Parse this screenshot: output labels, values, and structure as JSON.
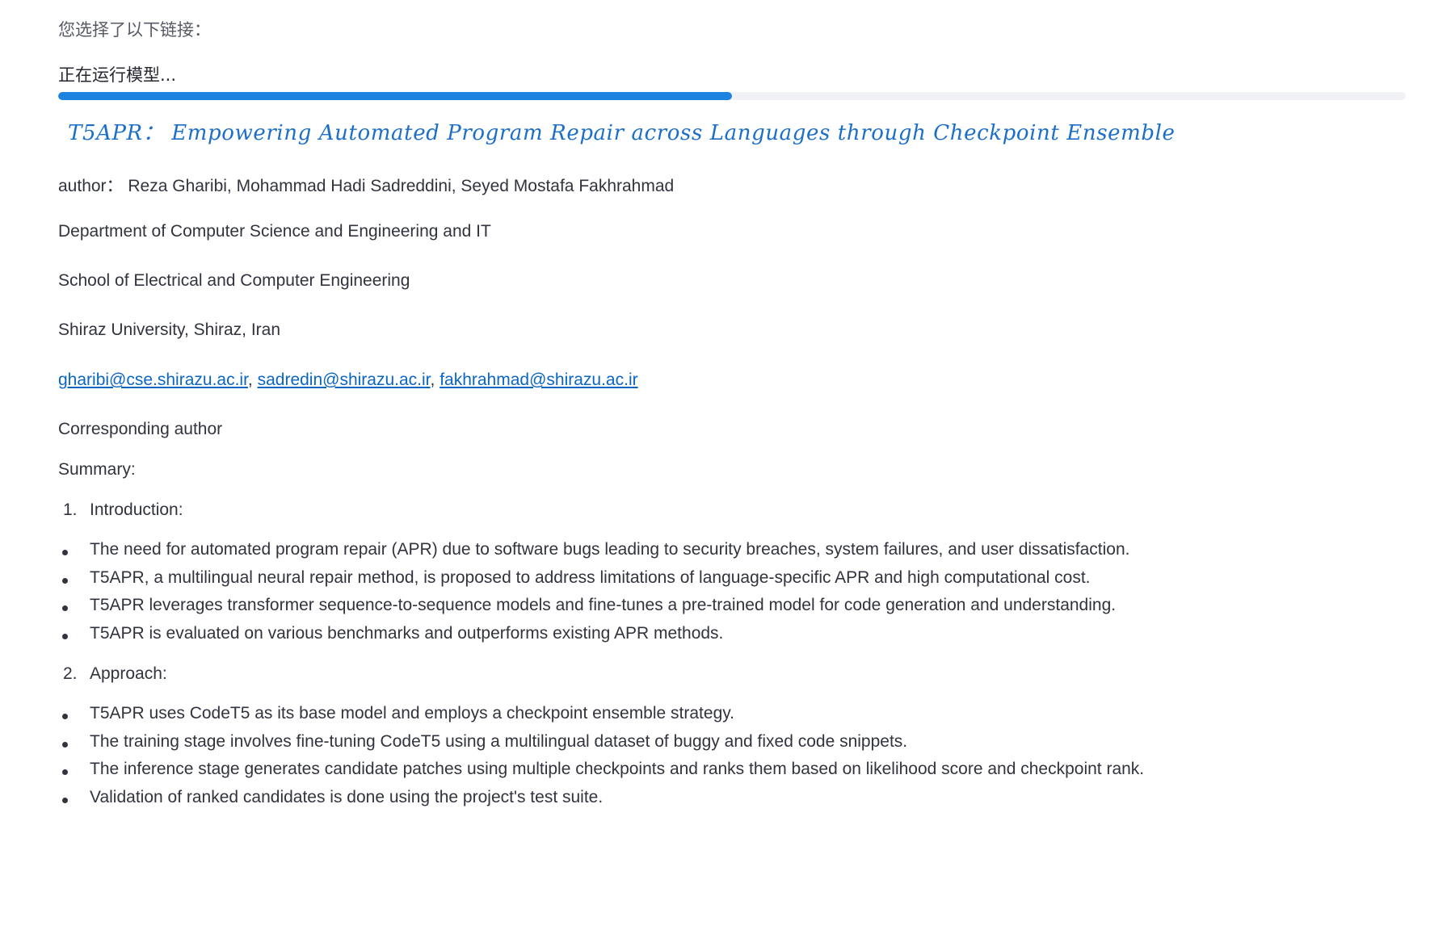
{
  "header": {
    "selected_links_label": "您选择了以下链接：",
    "status_text": "正在运行模型..."
  },
  "progress": {
    "fraction": 0.5,
    "fill_color": "#1c83e1",
    "track_color": "#f0f2f6"
  },
  "paper": {
    "title": "T5APR： Empowering Automated Program Repair across Languages through Checkpoint Ensemble",
    "author_line": "author： Reza Gharibi, Mohammad Hadi Sadreddini, Seyed Mostafa Fakhrahmad",
    "affiliations": [
      "Department of Computer Science and Engineering and IT",
      "School of Electrical and Computer Engineering",
      "Shiraz University, Shiraz, Iran"
    ],
    "emails": [
      "gharibi@cse.shirazu.ac.ir",
      "sadredin@shirazu.ac.ir",
      "fakhrahmad@shirazu.ac.ir"
    ],
    "email_separator": ", ",
    "corresponding": "Corresponding author"
  },
  "summary": {
    "label": "Summary:",
    "sections": [
      {
        "number": "1.",
        "title": "Introduction:",
        "bullets": [
          "The need for automated program repair (APR) due to software bugs leading to security breaches, system failures, and user dissatisfaction.",
          "T5APR, a multilingual neural repair method, is proposed to address limitations of language-specific APR and high computational cost.",
          "T5APR leverages transformer sequence-to-sequence models and fine-tunes a pre-trained model for code generation and understanding.",
          "T5APR is evaluated on various benchmarks and outperforms existing APR methods."
        ]
      },
      {
        "number": "2.",
        "title": "Approach:",
        "bullets": [
          "T5APR uses CodeT5 as its base model and employs a checkpoint ensemble strategy.",
          "The training stage involves fine-tuning CodeT5 using a multilingual dataset of buggy and fixed code snippets.",
          "The inference stage generates candidate patches using multiple checkpoints and ranks them based on likelihood score and checkpoint rank.",
          "Validation of ranked candidates is done using the project's test suite."
        ]
      }
    ]
  }
}
